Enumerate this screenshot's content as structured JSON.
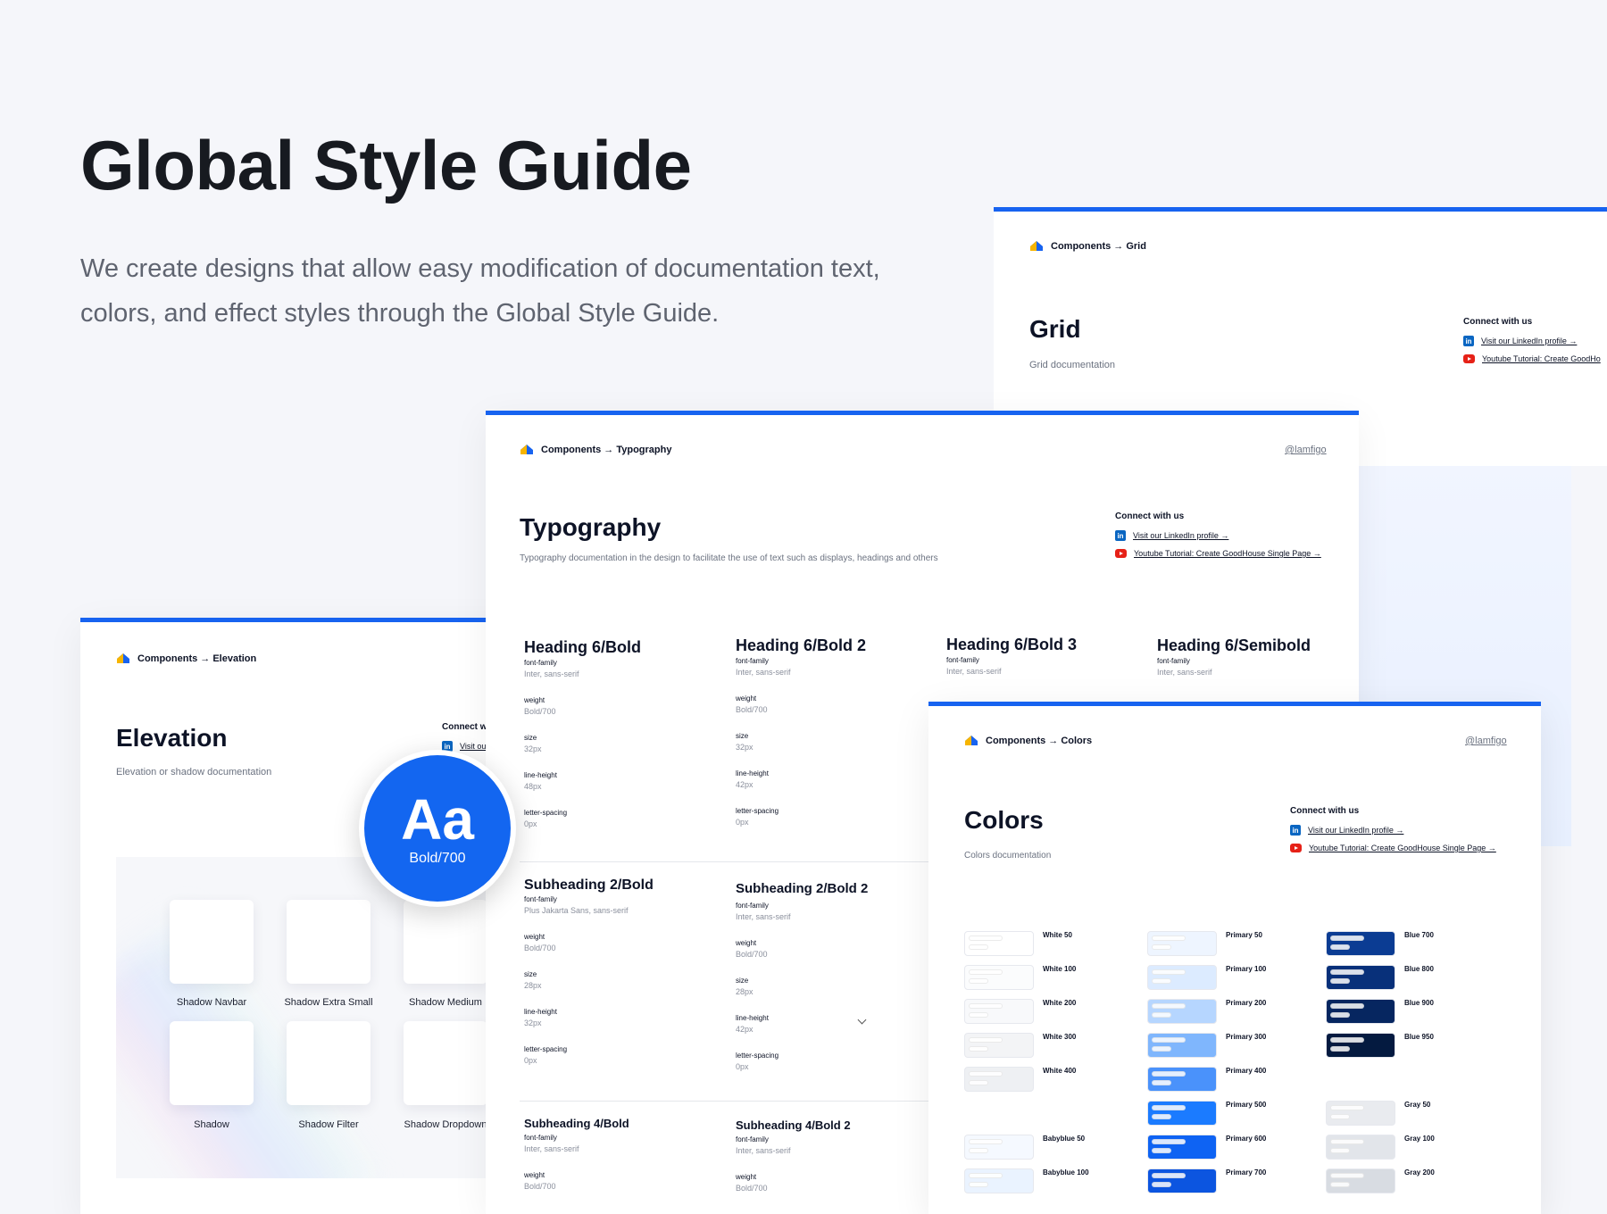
{
  "hero": {
    "title": "Global Style Guide",
    "description": "We create designs that allow easy modification of documentation text, colors, and effect styles through the Global Style Guide."
  },
  "colors_theme": {
    "accent": "#1763f0",
    "text": "#0d1326",
    "muted": "#6b7280"
  },
  "grid_card": {
    "breadcrumb": "Components → Grid",
    "title": "Grid",
    "subtitle": "Grid documentation",
    "connect": {
      "heading": "Connect with us",
      "linkedin": "Visit our LinkedIn profile →",
      "youtube": "Youtube Tutorial: Create GoodHo"
    }
  },
  "typography_card": {
    "breadcrumb": "Components → Typography",
    "handle": "@lamfigo",
    "title": "Typography",
    "subtitle": "Typography documentation in the design to facilitate the use of text such as displays, headings and others",
    "connect": {
      "heading": "Connect with us",
      "linkedin": "Visit our LinkedIn profile →",
      "youtube": "Youtube Tutorial: Create GoodHouse Single Page →"
    },
    "row1": [
      {
        "name": "Heading 6/Bold",
        "family": "Inter, sans-serif",
        "weight": "Bold/700",
        "size": "32px",
        "line_height": "48px",
        "letter_spacing": "0px"
      },
      {
        "name": "Heading 6/Bold 2",
        "family": "Inter, sans-serif",
        "weight": "Bold/700",
        "size": "32px",
        "line_height": "42px",
        "letter_spacing": "0px"
      },
      {
        "name": "Heading 6/Bold 3",
        "family": "Inter, sans-serif"
      },
      {
        "name": "Heading 6/Semibold",
        "family": "Inter, sans-serif"
      }
    ],
    "row2": [
      {
        "name": "Subheading 2/Bold",
        "family": "Plus Jakarta Sans, sans-serif",
        "weight": "Bold/700",
        "size": "28px",
        "line_height": "32px",
        "letter_spacing": "0px"
      },
      {
        "name": "Subheading 2/Bold 2",
        "family": "Inter, sans-serif",
        "weight": "Bold/700",
        "size": "28px",
        "line_height": "42px",
        "letter_spacing": "0px"
      }
    ],
    "row3": [
      {
        "name": "Subheading 4/Bold",
        "family": "Inter, sans-serif",
        "weight": "Bold/700"
      },
      {
        "name": "Subheading 4/Bold 2",
        "family": "Inter, sans-serif",
        "weight": "Bold/700"
      }
    ],
    "labels": {
      "family": "font-family",
      "weight": "weight",
      "size": "size",
      "line_height": "line-height",
      "letter_spacing": "letter-spacing"
    }
  },
  "elevation_card": {
    "breadcrumb": "Components → Elevation",
    "title": "Elevation",
    "subtitle": "Elevation or shadow documentation",
    "connect_heading": "Connect w",
    "linkedin": "Visit ou",
    "shadows_row1": [
      "Shadow Navbar",
      "Shadow Extra Small",
      "Shadow Medium"
    ],
    "shadows_row2": [
      "Shadow",
      "Shadow Filter",
      "Shadow Dropdown"
    ]
  },
  "badge": {
    "glyph": "Aa",
    "weight": "Bold/700"
  },
  "colors_card": {
    "breadcrumb": "Components → Colors",
    "handle": "@lamfigo",
    "title": "Colors",
    "subtitle": "Colors documentation",
    "connect": {
      "heading": "Connect with us",
      "linkedin": "Visit our LinkedIn profile →",
      "youtube": "Youtube Tutorial: Create GoodHouse Single Page →"
    },
    "white": [
      {
        "name": "White 50",
        "color": "#ffffff"
      },
      {
        "name": "White 100",
        "color": "#fbfcfd"
      },
      {
        "name": "White 200",
        "color": "#f8f9fb"
      },
      {
        "name": "White 300",
        "color": "#f3f4f6"
      },
      {
        "name": "White 400",
        "color": "#eef0f3"
      }
    ],
    "babyblue": [
      {
        "name": "Babyblue 50",
        "color": "#f5f9ff"
      },
      {
        "name": "Babyblue 100",
        "color": "#eaf3ff"
      }
    ],
    "primary": [
      {
        "name": "Primary 50",
        "color": "#eef5ff"
      },
      {
        "name": "Primary 100",
        "color": "#dcebff"
      },
      {
        "name": "Primary 200",
        "color": "#b6d6ff"
      },
      {
        "name": "Primary 300",
        "color": "#7fb6fd"
      },
      {
        "name": "Primary 400",
        "color": "#4a92fb"
      },
      {
        "name": "Primary 500",
        "color": "#1b7bff"
      },
      {
        "name": "Primary 600",
        "color": "#0e63f3"
      },
      {
        "name": "Primary 700",
        "color": "#0c55e0"
      }
    ],
    "blue": [
      {
        "name": "Blue 700",
        "color": "#0b3c93"
      },
      {
        "name": "Blue 800",
        "color": "#08307a"
      },
      {
        "name": "Blue 900",
        "color": "#062660"
      },
      {
        "name": "Blue 950",
        "color": "#041a40"
      }
    ],
    "gray": [
      {
        "name": "Gray 50",
        "color": "#e9ebef"
      },
      {
        "name": "Gray 100",
        "color": "#e2e5ea"
      },
      {
        "name": "Gray 200",
        "color": "#d8dce2"
      }
    ]
  }
}
